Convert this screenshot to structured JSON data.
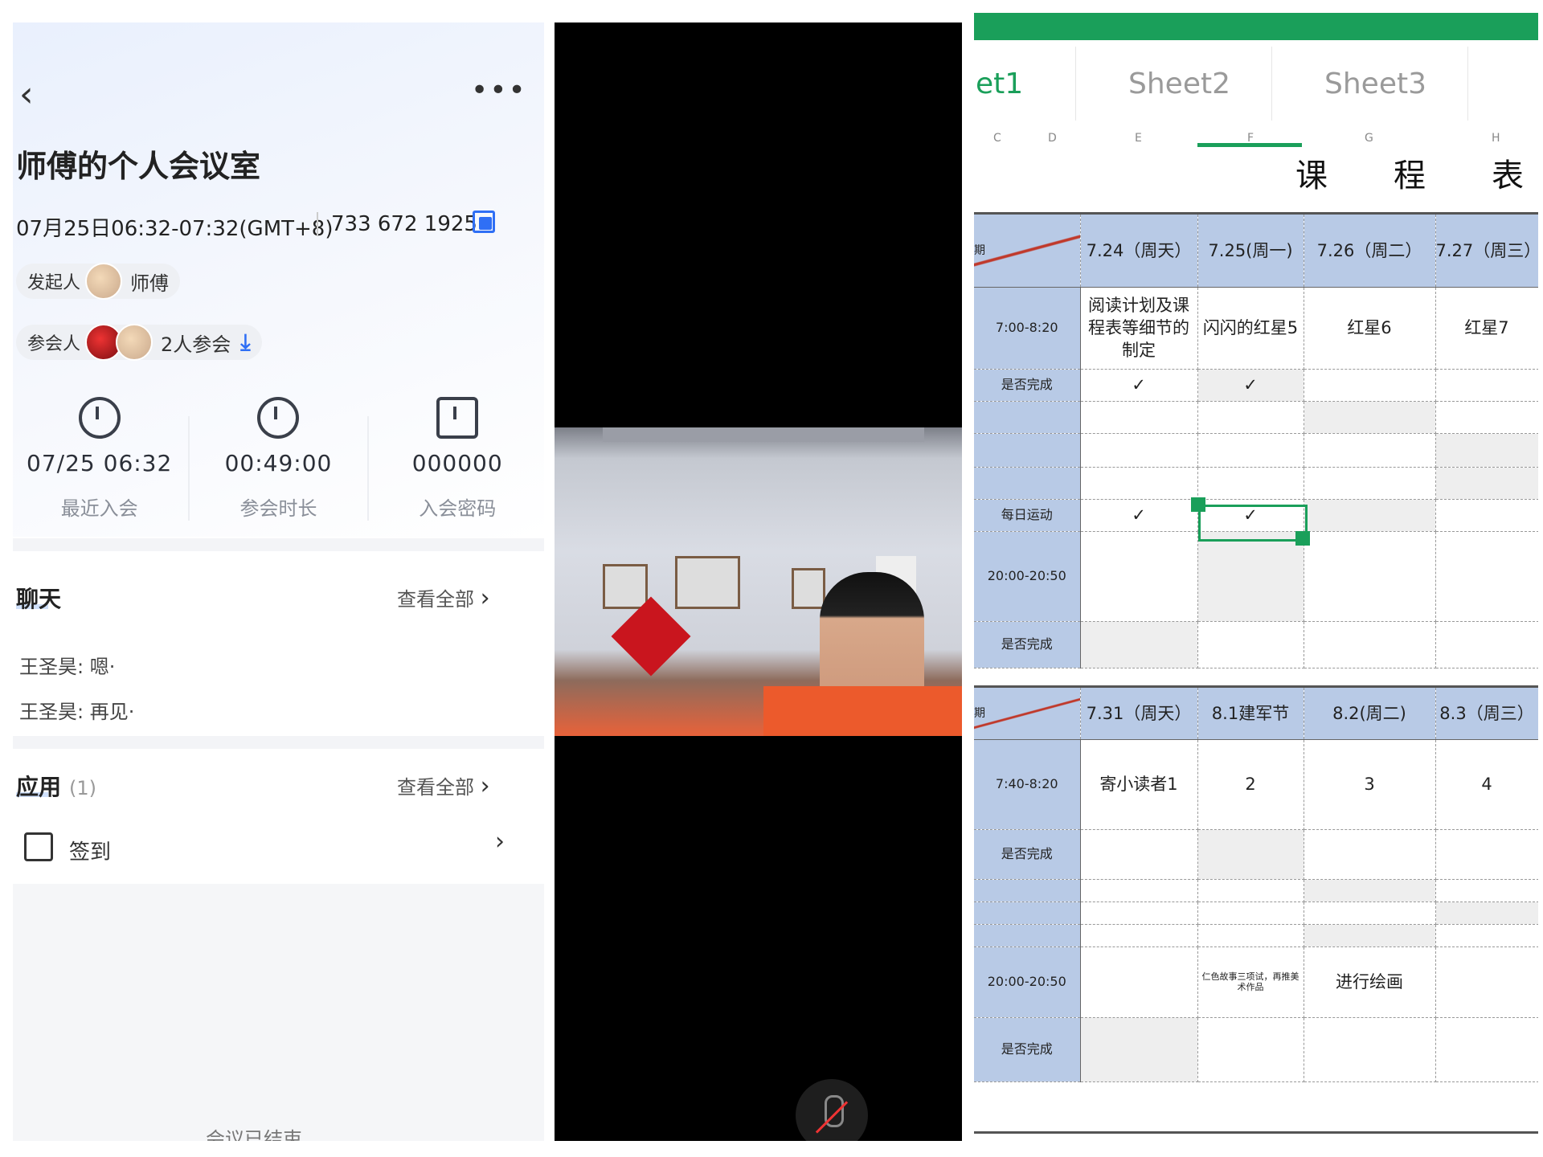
{
  "meeting": {
    "title": "师傅的个人会议室",
    "time": "07月25日06:32-07:32(GMT+8)",
    "meeting_id": "733 672 1925",
    "host_label": "发起人",
    "host_name": "师傅",
    "participants_label": "参会人",
    "participants_count": "2人参会",
    "stats": [
      {
        "value": "07/25 06:32",
        "label": "最近入会"
      },
      {
        "value": "00:49:00",
        "label": "参会时长"
      },
      {
        "value": "000000",
        "label": "入会密码"
      }
    ],
    "chat_title": "聊天",
    "view_all": "查看全部",
    "chat_messages": [
      "王圣昊: 嗯·",
      "王圣昊: 再见·"
    ],
    "apps_title": "应用",
    "apps_count": "(1)",
    "app_item": "签到",
    "ended_text": "会议已结束"
  },
  "spreadsheet": {
    "tabs": [
      "et1",
      "Sheet2",
      "Sheet3"
    ],
    "col_headers": [
      "C",
      "D",
      "E",
      "F",
      "G",
      "H"
    ],
    "title_chars": [
      "课",
      "程",
      "表"
    ],
    "week1": {
      "corner": "期",
      "dates": [
        "7.24（周天）",
        "7.25(周一)",
        "7.26（周二）",
        "7.27（周三）"
      ],
      "rows": [
        {
          "label": "7:00-8:20",
          "cells": [
            "阅读计划及课程表等细节的制定",
            "闪闪的红星5",
            "红星6",
            "红星7"
          ]
        },
        {
          "label": "是否完成",
          "cells": [
            "✓",
            "✓",
            "",
            ""
          ]
        },
        {
          "label": "",
          "cells": [
            "",
            "",
            "",
            ""
          ]
        },
        {
          "label": "",
          "cells": [
            "",
            "",
            "",
            ""
          ]
        },
        {
          "label": "",
          "cells": [
            "",
            "",
            "",
            ""
          ]
        },
        {
          "label": "每日运动",
          "cells": [
            "✓",
            "✓",
            "",
            ""
          ]
        },
        {
          "label": "20:00-20:50",
          "cells": [
            "",
            "",
            "",
            ""
          ]
        },
        {
          "label": "是否完成",
          "cells": [
            "",
            "",
            "",
            ""
          ]
        }
      ]
    },
    "week2": {
      "corner": "期",
      "dates": [
        "7.31（周天）",
        "8.1建军节",
        "8.2(周二)",
        "8.3（周三）"
      ],
      "rows": [
        {
          "label": "7:40-8:20",
          "cells": [
            "寄小读者1",
            "2",
            "3",
            "4"
          ]
        },
        {
          "label": "是否完成",
          "cells": [
            "",
            "",
            "",
            ""
          ]
        },
        {
          "label": "",
          "cells": [
            "",
            "",
            "",
            ""
          ]
        },
        {
          "label": "",
          "cells": [
            "",
            "",
            "",
            ""
          ]
        },
        {
          "label": "",
          "cells": [
            "",
            "",
            "",
            ""
          ]
        },
        {
          "label": "20:00-20:50",
          "cells": [
            "",
            "仁色故事三项试，再推美术作品",
            "进行绘画",
            ""
          ]
        },
        {
          "label": "是否完成",
          "cells": [
            "",
            "",
            "",
            ""
          ]
        }
      ]
    }
  },
  "colors": {
    "accent_blue": "#2f6ff5",
    "sheet_green": "#1a9f5a",
    "header_blue": "#b8cae6"
  }
}
